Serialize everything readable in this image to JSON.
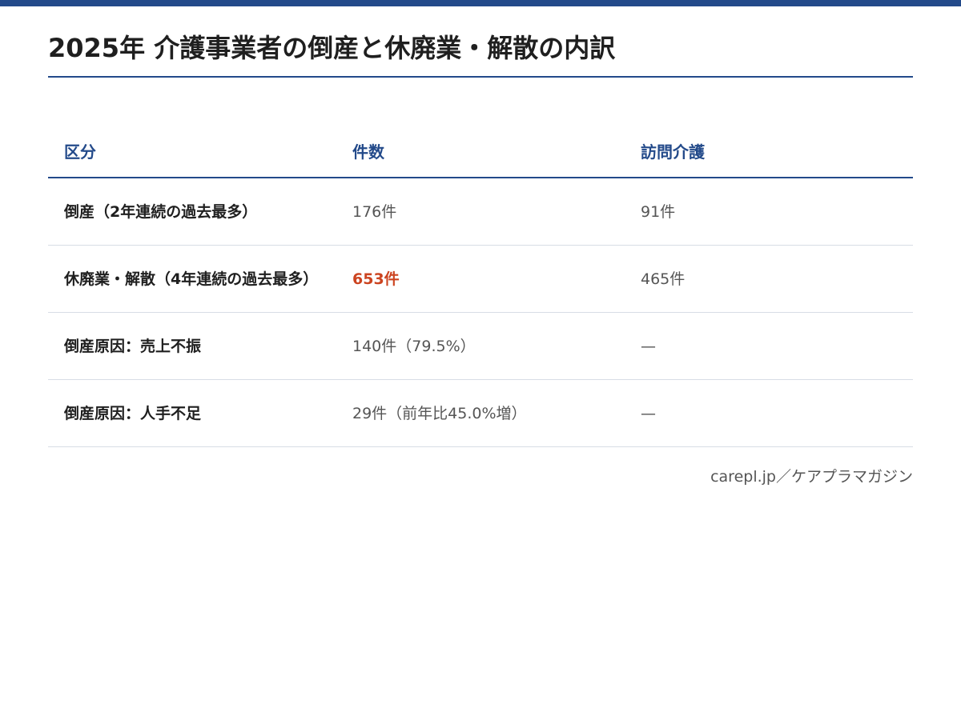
{
  "title": "2025年 介護事業者の倒産と休廃業・解散の内訳",
  "colors": {
    "accent": "#234a8a",
    "highlight": "#cc4420",
    "row_divider": "#d7dde5"
  },
  "chart_data": {
    "type": "table",
    "title": "2025年 介護事業者の倒産と休廃業・解散の内訳",
    "columns": [
      "区分",
      "件数",
      "訪問介護"
    ],
    "rows": [
      {
        "label": "倒産（2年連続の過去最多）",
        "count": "176件",
        "home_care": "91件",
        "highlight": false
      },
      {
        "label": "休廃業・解散（4年連続の過去最多）",
        "count": "653件",
        "home_care": "465件",
        "highlight": true
      },
      {
        "label": "倒産原因：売上不振",
        "count": "140件（79.5%）",
        "home_care": "—",
        "highlight": false
      },
      {
        "label": "倒産原因：人手不足",
        "count": "29件（前年比45.0%増）",
        "home_care": "—",
        "highlight": false
      }
    ]
  },
  "source": "carepl.jp／ケアプラマガジン"
}
